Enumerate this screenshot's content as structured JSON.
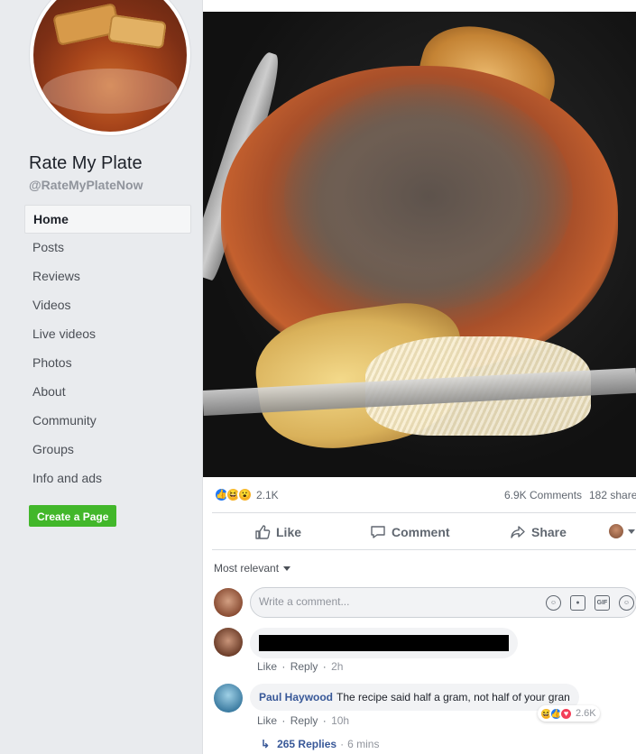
{
  "page": {
    "name": "Rate My Plate",
    "handle": "@RateMyPlateNow"
  },
  "sidebar": {
    "items": [
      {
        "label": "Home",
        "active": true
      },
      {
        "label": "Posts"
      },
      {
        "label": "Reviews"
      },
      {
        "label": "Videos"
      },
      {
        "label": "Live videos"
      },
      {
        "label": "Photos"
      },
      {
        "label": "About"
      },
      {
        "label": "Community"
      },
      {
        "label": "Groups"
      },
      {
        "label": "Info and ads"
      }
    ],
    "create_page": "Create a Page"
  },
  "post": {
    "reaction_count": "2.1K",
    "reaction_icons": [
      "like-icon",
      "haha-icon",
      "wow-icon"
    ],
    "comments_count": "6.9K Comments",
    "shares_count": "182 share",
    "actions": {
      "like": "Like",
      "comment": "Comment",
      "share": "Share"
    },
    "sort_label": "Most relevant",
    "composer_placeholder": "Write a comment...",
    "composer_icons": [
      "emoji-icon",
      "camera-icon",
      "gif-icon",
      "sticker-icon"
    ]
  },
  "comments": [
    {
      "author": "",
      "text": "",
      "redacted": true,
      "like": "Like",
      "reply": "Reply",
      "time": "2h"
    },
    {
      "author": "Paul Haywood",
      "text": "The recipe said half a gram, not half of your gran",
      "like": "Like",
      "reply": "Reply",
      "time": "10h",
      "reaction_count": "2.6K",
      "reaction_icons": [
        "haha-icon",
        "like-icon",
        "love-icon"
      ],
      "replies_label": "265 Replies",
      "replies_time": "6 mins"
    }
  ],
  "colors": {
    "link": "#385898",
    "create_btn": "#42b72a",
    "like_blue": "#2078f4",
    "love_red": "#f33e58"
  }
}
